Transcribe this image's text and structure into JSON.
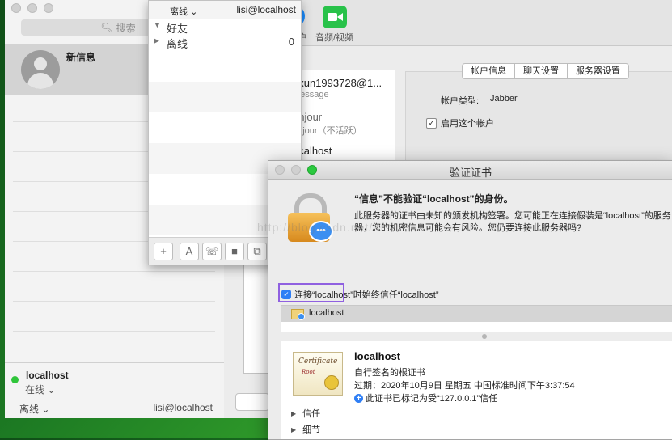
{
  "messages_window": {
    "search_placeholder": "搜索",
    "conversation_title": "新信息",
    "account_host": "localhost",
    "account_status": "在线",
    "bottom_status": "离线",
    "bottom_account": "lisi@localhost"
  },
  "preferences_window": {
    "av_label": "音频/视频",
    "partial_label": "户",
    "accounts": [
      {
        "name": "uxun1993728@1...",
        "service": "Message"
      },
      {
        "name": "onjour",
        "service": "onjour（不活跃）"
      },
      {
        "name": "ocalhost",
        "service": ""
      }
    ],
    "tabs": [
      "帐户信息",
      "聊天设置",
      "服务器设置"
    ],
    "account_type_label": "帐户类型:",
    "account_type_value": "Jabber",
    "enable_account_label": "启用这个帐户",
    "enable_checked": true
  },
  "buddy_window": {
    "status": "离线",
    "account": "lisi@localhost",
    "groups": [
      {
        "name": "好友",
        "expanded": true,
        "count": ""
      },
      {
        "name": "离线",
        "expanded": false,
        "count": "0"
      }
    ]
  },
  "cert_dialog": {
    "title": "验证证书",
    "heading": "“信息”不能验证“localhost”的身份。",
    "description": "此服务器的证书由未知的颁发机构签署。您可能正在连接假装是“localhost”的服务器，您的机密信息可能会有风险。您仍要连接此服务器吗?",
    "trust_label": "连接“localhost”时始终信任“localhost”",
    "trust_checked": true,
    "cert_list_item": "localhost",
    "cert_name": "localhost",
    "cert_subtitle": "自行签名的根证书",
    "cert_expiry": "过期：2020年10月9日 星期五 中国标准时间下午3:37:54",
    "cert_trust_note": "此证书已标记为受“127.0.0.1”信任",
    "badge_text_1": "Certificate",
    "badge_text_2": "Root",
    "sections": [
      "信任",
      "细节"
    ]
  },
  "watermark": "http://blog.csdn.net/"
}
